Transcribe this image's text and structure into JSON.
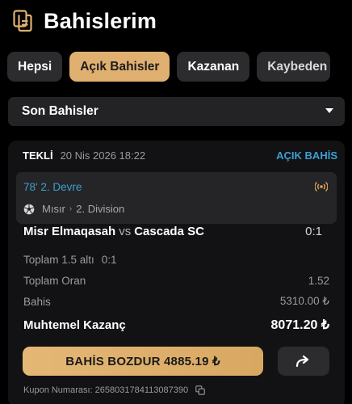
{
  "header": {
    "title": "Bahislerim",
    "icon": "document-stack-icon"
  },
  "tabs": [
    {
      "label": "Hepsi",
      "active": false
    },
    {
      "label": "Açık Bahisler",
      "active": true
    },
    {
      "label": "Kazanan",
      "active": false
    },
    {
      "label": "Kaybeden",
      "active": false
    }
  ],
  "filter": {
    "selected": "Son Bahisler",
    "icon": "caret-down-icon"
  },
  "bet": {
    "type": "TEKLİ",
    "date": "20 Nis 2026 18:22",
    "status": "AÇIK BAHİS",
    "event": {
      "minute": "78' 2. Devre",
      "country": "Mısır",
      "league": "2. Division",
      "home": "Misr Elmaqasah",
      "vs": "vs",
      "away": "Cascada SC",
      "score": "0:1"
    },
    "pick": {
      "market": "Toplam 1.5 altı",
      "selection": "0:1"
    },
    "total_odds": {
      "label": "Toplam Oran",
      "value": "1.52"
    },
    "stake": {
      "label": "Bahis",
      "value": "5310.00 ₺"
    },
    "potential_win": {
      "label": "Muhtemel Kazanç",
      "value": "8071.20 ₺"
    },
    "cashout_label": "BAHİS BOZDUR 4885.19 ₺",
    "coupon": "Kupon Numarası: 2658031784113087390"
  },
  "colors": {
    "accent": "#e0b070",
    "link": "#3b9fd2",
    "card": "#121214",
    "event_bg": "#252527"
  }
}
